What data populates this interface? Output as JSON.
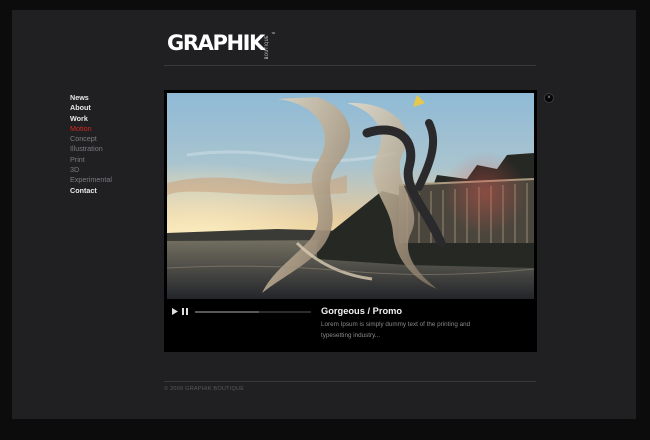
{
  "logo": {
    "text": "GRAPHIK",
    "sub": "BOUTIQUE",
    "tm": "™"
  },
  "nav": {
    "items": [
      {
        "label": "News",
        "type": "main",
        "active": false
      },
      {
        "label": "About",
        "type": "main",
        "active": false
      },
      {
        "label": "Work",
        "type": "main",
        "active": false
      },
      {
        "label": "Motion",
        "type": "sub",
        "active": true
      },
      {
        "label": "Concept",
        "type": "sub",
        "active": false
      },
      {
        "label": "Illustration",
        "type": "sub",
        "active": false
      },
      {
        "label": "Print",
        "type": "sub",
        "active": false
      },
      {
        "label": "3D",
        "type": "sub",
        "active": false
      },
      {
        "label": "Experimental",
        "type": "sub",
        "active": false
      },
      {
        "label": "Contact",
        "type": "main",
        "active": false
      }
    ]
  },
  "player": {
    "title": "Gorgeous / Promo",
    "description": "Lorem Ipsum is simply dummy text of the printing and typesetting industry...",
    "progress": 0.55,
    "play_icon": "play-icon",
    "pause_icon": "pause-icon"
  },
  "close": {
    "icon": "close-icon",
    "glyph": "×"
  },
  "footer": {
    "text": "© 2009 GRAPHIK BOUTIQUE"
  },
  "colors": {
    "accent": "#d2281e",
    "panel": "#202023",
    "background": "#0c0c0d"
  }
}
